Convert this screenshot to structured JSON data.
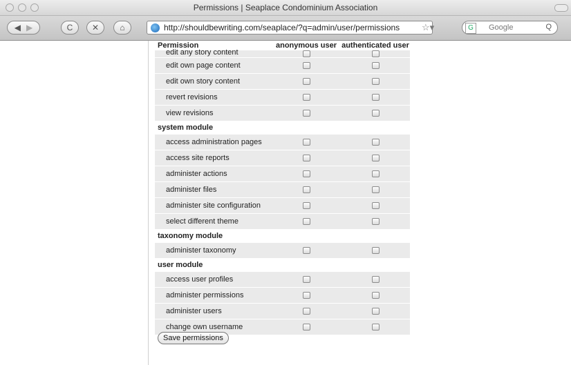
{
  "window": {
    "title": "Permissions | Seaplace Condominium Association"
  },
  "toolbar": {
    "url": "http://shouldbewriting.com/seaplace/?q=admin/user/permissions",
    "search_placeholder": "Google",
    "back_glyph": "◀",
    "forward_glyph": "▶",
    "reload_glyph": "C",
    "stop_glyph": "✕",
    "home_glyph": "⌂",
    "star_glyph": "☆▾",
    "search_glyph": "Q"
  },
  "table": {
    "headers": {
      "permission": "Permission",
      "anonymous": "anonymous user",
      "authenticated": "authenticated user"
    },
    "clipped_row": "edit any story content",
    "rows": [
      {
        "type": "perm",
        "label": "edit own page content"
      },
      {
        "type": "perm",
        "label": "edit own story content"
      },
      {
        "type": "perm",
        "label": "revert revisions"
      },
      {
        "type": "perm",
        "label": "view revisions"
      },
      {
        "type": "module",
        "label": "system module"
      },
      {
        "type": "perm",
        "label": "access administration pages"
      },
      {
        "type": "perm",
        "label": "access site reports"
      },
      {
        "type": "perm",
        "label": "administer actions"
      },
      {
        "type": "perm",
        "label": "administer files"
      },
      {
        "type": "perm",
        "label": "administer site configuration"
      },
      {
        "type": "perm",
        "label": "select different theme"
      },
      {
        "type": "module",
        "label": "taxonomy module"
      },
      {
        "type": "perm",
        "label": "administer taxonomy"
      },
      {
        "type": "module",
        "label": "user module"
      },
      {
        "type": "perm",
        "label": "access user profiles"
      },
      {
        "type": "perm",
        "label": "administer permissions"
      },
      {
        "type": "perm",
        "label": "administer users"
      },
      {
        "type": "perm",
        "label": "change own username"
      }
    ]
  },
  "save_button": "Save permissions"
}
